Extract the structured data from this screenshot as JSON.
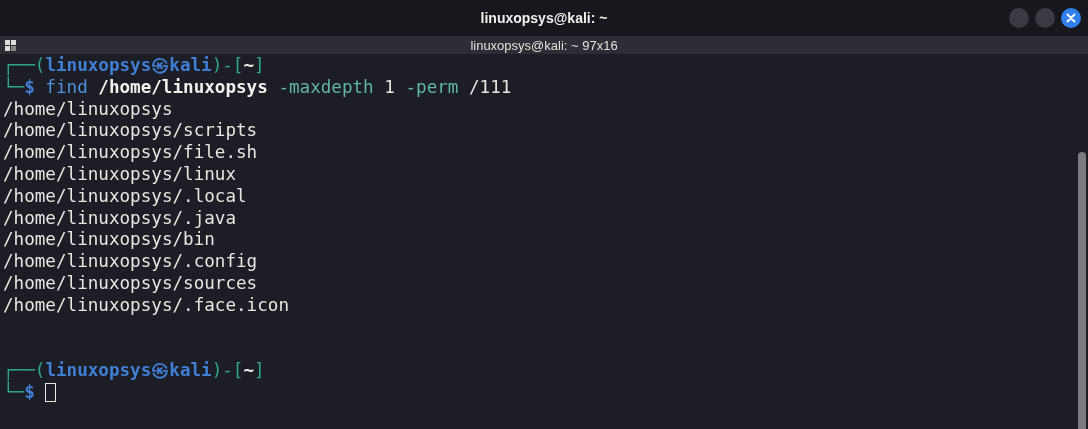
{
  "window": {
    "title": "linuxopsys@kali: ~"
  },
  "tab": {
    "title": "linuxopsys@kali: ~ 97x16"
  },
  "lines": [
    [
      {
        "kind": "frame",
        "text": "┌──("
      },
      {
        "kind": "user",
        "text": "linuxopsys㉿kali"
      },
      {
        "kind": "frame",
        "text": ")-["
      },
      {
        "kind": "path",
        "text": "~"
      },
      {
        "kind": "frame",
        "text": "]"
      }
    ],
    [
      {
        "kind": "frame",
        "text": "└─"
      },
      {
        "kind": "dollar",
        "text": "$"
      },
      {
        "kind": "cmd",
        "text": "find"
      },
      {
        "kind": "arg",
        "text": "/home/linuxopsys"
      },
      {
        "kind": "flag",
        "text": "-maxdepth"
      },
      {
        "kind": "number",
        "text": "1"
      },
      {
        "kind": "flag",
        "text": "-perm"
      },
      {
        "kind": "number",
        "text": "/111"
      }
    ],
    [
      {
        "kind": "output",
        "text": "/home/linuxopsys"
      }
    ],
    [
      {
        "kind": "output",
        "text": "/home/linuxopsys/scripts"
      }
    ],
    [
      {
        "kind": "output",
        "text": "/home/linuxopsys/file.sh"
      }
    ],
    [
      {
        "kind": "output",
        "text": "/home/linuxopsys/linux"
      }
    ],
    [
      {
        "kind": "output",
        "text": "/home/linuxopsys/.local"
      }
    ],
    [
      {
        "kind": "output",
        "text": "/home/linuxopsys/.java"
      }
    ],
    [
      {
        "kind": "output",
        "text": "/home/linuxopsys/bin"
      }
    ],
    [
      {
        "kind": "output",
        "text": "/home/linuxopsys/.config"
      }
    ],
    [
      {
        "kind": "output",
        "text": "/home/linuxopsys/sources"
      }
    ],
    [
      {
        "kind": "output",
        "text": "/home/linuxopsys/.face.icon"
      }
    ],
    {
      "kind": "blank"
    },
    {
      "kind": "blank"
    },
    [
      {
        "kind": "frame",
        "text": "┌──("
      },
      {
        "kind": "user",
        "text": "linuxopsys㉿kali"
      },
      {
        "kind": "frame",
        "text": ")-["
      },
      {
        "kind": "path",
        "text": "~"
      },
      {
        "kind": "frame",
        "text": "]"
      }
    ],
    [
      {
        "kind": "frame",
        "text": "└─"
      },
      {
        "kind": "dollar",
        "text": "$"
      },
      {
        "kind": "cursor"
      }
    ]
  ]
}
